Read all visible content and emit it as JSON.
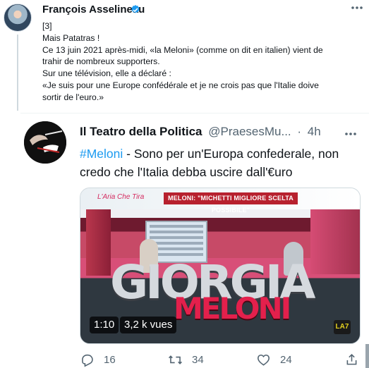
{
  "top_tweet": {
    "author": "François Asselineau",
    "verified": true,
    "text_lines": [
      "[3]",
      "Mais Patatras !",
      "Ce 13 juin 2021 après-midi, «la Meloni» (comme on dit en italien) vient de",
      "trahir de nombreux supporters.",
      "Sur une télévision, elle a déclaré :",
      "«Je suis pour une Europe confédérale et je ne crois pas que l'Italie doive",
      "sortir de l'euro.»"
    ]
  },
  "reply": {
    "name": "Il Teatro della Politica",
    "handle": "@PraesesMu...",
    "separator": "·",
    "time": "4h",
    "hashtag": "#Meloni",
    "text_line1_rest": " - Sono per un'Europa confederale, non",
    "text_line2": "credo che l'Italia debba uscire dall'€uro",
    "video": {
      "logo": "L'Aria Che Tira",
      "caption": "MELONI: \"MICHETTI MIGLIORE SCELTA POSSIBILE\"",
      "overlay_big": "GIORGIA",
      "overlay_red": "MELONI",
      "channel": "LA7",
      "duration": "1:10",
      "views": "3,2 k vues"
    },
    "actions": {
      "replies": "16",
      "retweets": "34",
      "likes": "24"
    }
  },
  "colors": {
    "accent": "#1d9bf0",
    "text": "#0f1419",
    "muted": "#536471",
    "red_overlay": "#e3204c"
  },
  "icons": [
    "verified-badge-icon",
    "more-icon",
    "reply-icon",
    "retweet-icon",
    "like-icon",
    "share-icon"
  ]
}
